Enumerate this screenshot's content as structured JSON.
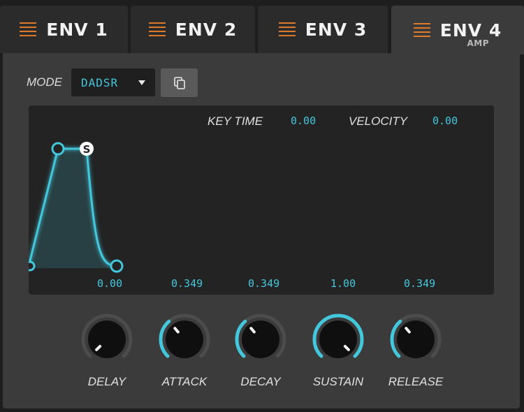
{
  "tabs": [
    {
      "label": "ENV 1",
      "sub": ""
    },
    {
      "label": "ENV 2",
      "sub": ""
    },
    {
      "label": "ENV 3",
      "sub": ""
    },
    {
      "label": "ENV 4",
      "sub": "AMP"
    }
  ],
  "active_tab": 3,
  "mode": {
    "label": "MODE",
    "value": "DADSR"
  },
  "envelope": {
    "key_time_label": "KEY TIME",
    "key_time_value": "0.00",
    "velocity_label": "VELOCITY",
    "velocity_value": "0.00",
    "sustain_marker": "S",
    "stage_values": [
      "0.00",
      "0.349",
      "0.349",
      "1.00",
      "0.349"
    ]
  },
  "knobs": [
    {
      "label": "DELAY",
      "value": 0.0
    },
    {
      "label": "ATTACK",
      "value": 0.349
    },
    {
      "label": "DECAY",
      "value": 0.349
    },
    {
      "label": "SUSTAIN",
      "value": 1.0
    },
    {
      "label": "RELEASE",
      "value": 0.349
    }
  ],
  "colors": {
    "accent": "#43c7dc",
    "tab_icon": "#e07a2b"
  }
}
